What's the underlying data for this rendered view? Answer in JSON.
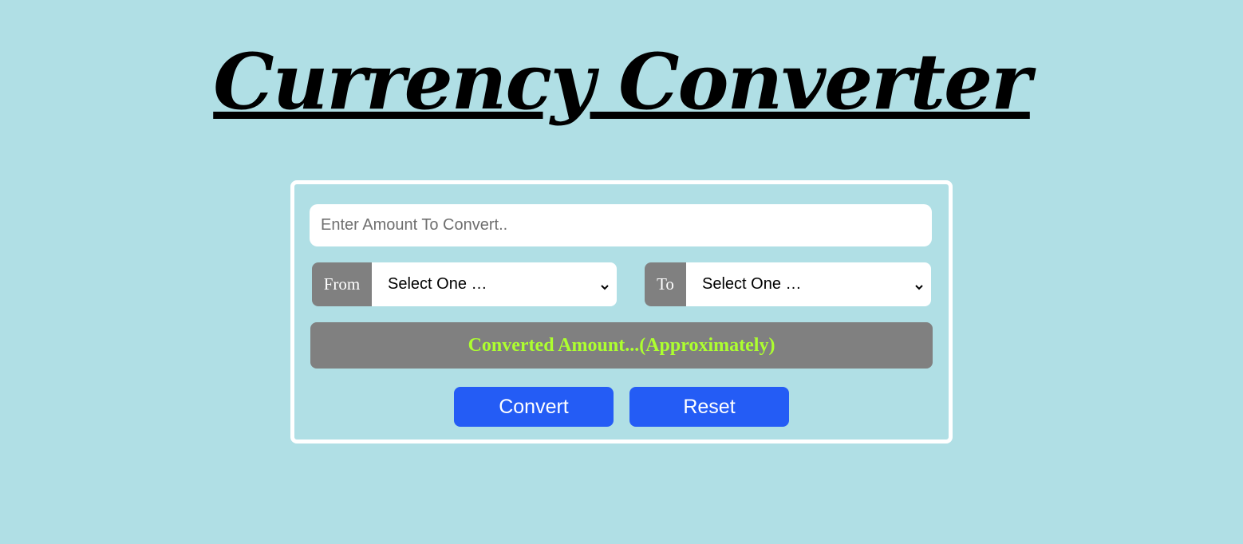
{
  "header": {
    "title": "Currency Converter"
  },
  "form": {
    "amount_placeholder": "Enter Amount To Convert..",
    "amount_value": "",
    "from_label": "From",
    "from_selected": "Select One …",
    "to_label": "To",
    "to_selected": "Select One …",
    "result_text": "Converted Amount...(Approximately)",
    "convert_label": "Convert",
    "reset_label": "Reset"
  },
  "colors": {
    "background": "#b0dfe5",
    "button": "#245cf5",
    "result_bar": "#808080",
    "result_text": "#adff2f",
    "card_border": "#ffffff"
  }
}
